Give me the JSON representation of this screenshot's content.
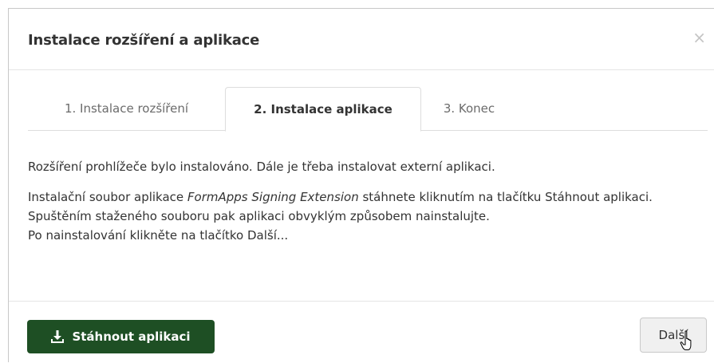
{
  "dialog": {
    "title": "Instalace rozšíření a aplikace",
    "close_symbol": "×"
  },
  "tabs": [
    {
      "label": "1. Instalace rozšíření",
      "active": false
    },
    {
      "label": "2. Instalace aplikace",
      "active": true
    },
    {
      "label": "3. Konec",
      "active": false
    }
  ],
  "content": {
    "paragraph1": "Rozšíření prohlížeče bylo instalováno. Dále je třeba instalovat externí aplikaci.",
    "p2_before": "Instalační soubor aplikace ",
    "p2_app_name": "FormApps Signing Extension",
    "p2_after": " stáhnete kliknutím na tlačítku Stáhnout aplikaci. Spuštěním staženého souboru pak aplikaci obvyklým způsobem nainstalujte.",
    "p2_last": "Po nainstalování klikněte na tlačítko Další..."
  },
  "footer": {
    "download_label": "Stáhnout aplikaci",
    "next_label": "Další"
  },
  "colors": {
    "primary_button": "#1e4f24",
    "secondary_button": "#f0f0f0"
  },
  "icons": {
    "download": "download-icon",
    "close": "close-icon",
    "cursor": "hand-pointer-icon"
  }
}
